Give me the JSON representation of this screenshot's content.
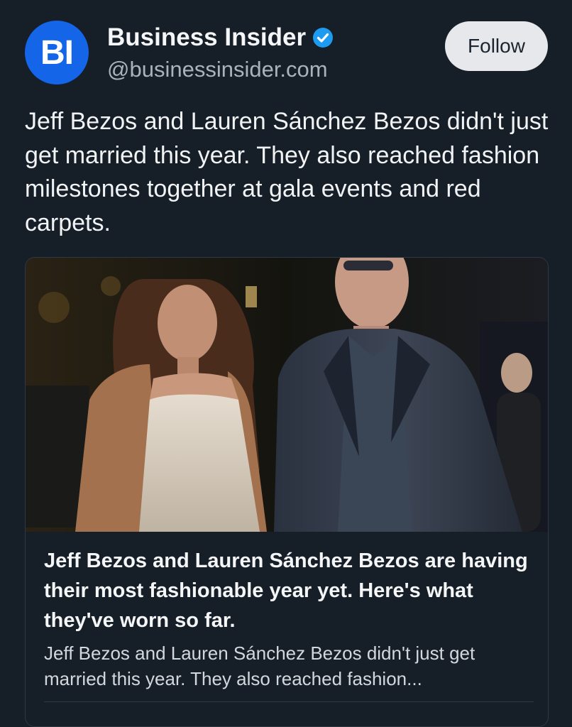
{
  "account": {
    "avatar_text": "BI",
    "name": "Business Insider",
    "handle": "@businessinsider.com",
    "verified": true,
    "follow_label": "Follow"
  },
  "post": {
    "text": "Jeff Bezos and Lauren Sánchez Bezos didn't just get married this year. They also reached fashion milestones together at gala events and red carpets."
  },
  "link_card": {
    "image_description": "photo-of-couple-at-night-event",
    "title": "Jeff Bezos and Lauren Sánchez Bezos are having their most fashionable year yet. Here's what they've worn so far.",
    "description": "Jeff Bezos and Lauren Sánchez Bezos didn't just get married this year. They also reached fashion..."
  },
  "colors": {
    "background": "#161e27",
    "avatar": "#1565e8",
    "verified": "#1d9bf0",
    "follow_bg": "#e6e8eb"
  }
}
